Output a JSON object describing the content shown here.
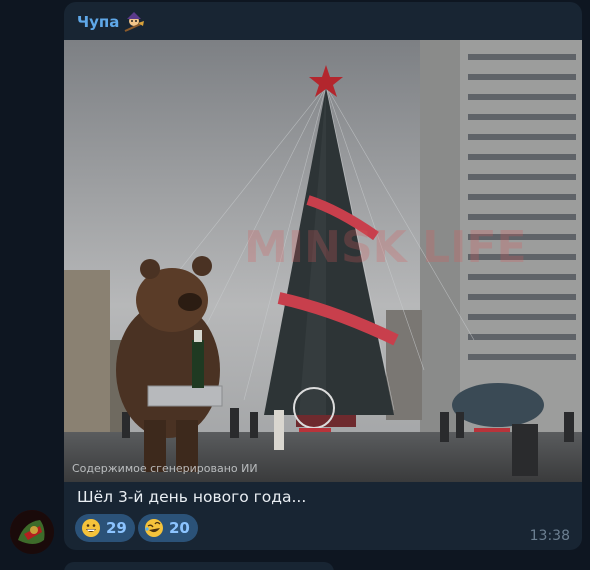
{
  "message": {
    "sender": "Чупа",
    "sender_emoji_icon": "broom-witch-icon",
    "caption": "Шёл 3-й день нового года...",
    "time": "13:38",
    "photo": {
      "watermark": "MINSK LIFE",
      "credit": "Содержимое сгенерировано ИИ",
      "description_icon": "bear-with-champagne-photo"
    },
    "reactions": [
      {
        "icon": "grinning-face-icon",
        "count": "29"
      },
      {
        "icon": "rofl-face-icon",
        "count": "20"
      }
    ]
  },
  "colors": {
    "background": "#0e1621",
    "bubble": "#182533",
    "sender": "#5fa8e8",
    "reaction_bg": "#2b5278",
    "reaction_count": "#8cc4ff",
    "time": "#6c7f91"
  }
}
